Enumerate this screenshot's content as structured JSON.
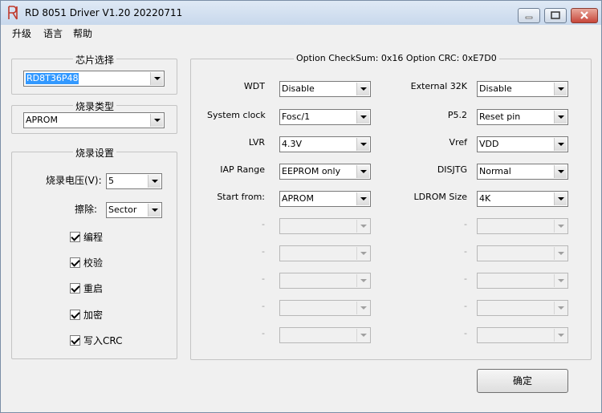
{
  "titlebar": {
    "title": "RD 8051 Driver V1.20 20220711"
  },
  "menu": [
    "升级",
    "语言",
    "帮助"
  ],
  "chip_select": {
    "title": "芯片选择",
    "value": "RD8T36P48"
  },
  "burn_type": {
    "title": "烧录类型",
    "value": "APROM"
  },
  "burn_settings": {
    "title": "烧录设置",
    "voltage_label": "烧录电压(V):",
    "voltage_value": "5",
    "erase_label": "擦除:",
    "erase_value": "Sector",
    "checkboxes": [
      {
        "label": "编程",
        "checked": true
      },
      {
        "label": "校验",
        "checked": true
      },
      {
        "label": "重启",
        "checked": true
      },
      {
        "label": "加密",
        "checked": true
      },
      {
        "label": "写入CRC",
        "checked": true
      }
    ]
  },
  "options": {
    "title": "Option CheckSum:  0x16  Option CRC:  0xE7D0",
    "left": [
      {
        "label": "WDT",
        "value": "Disable"
      },
      {
        "label": "System clock",
        "value": "Fosc/1"
      },
      {
        "label": "LVR",
        "value": "4.3V"
      },
      {
        "label": "IAP Range",
        "value": "EEPROM only"
      },
      {
        "label": "Start from:",
        "value": "APROM"
      },
      {
        "label": "-",
        "value": ""
      },
      {
        "label": "-",
        "value": ""
      },
      {
        "label": "-",
        "value": ""
      },
      {
        "label": "-",
        "value": ""
      },
      {
        "label": "-",
        "value": ""
      }
    ],
    "right": [
      {
        "label": "External 32K",
        "value": "Disable"
      },
      {
        "label": "P5.2",
        "value": "Reset pin"
      },
      {
        "label": "Vref",
        "value": "VDD"
      },
      {
        "label": "DISJTG",
        "value": "Normal"
      },
      {
        "label": "LDROM Size",
        "value": "4K"
      },
      {
        "label": "-",
        "value": ""
      },
      {
        "label": "-",
        "value": ""
      },
      {
        "label": "-",
        "value": ""
      },
      {
        "label": "-",
        "value": ""
      },
      {
        "label": "-",
        "value": ""
      }
    ]
  },
  "confirm_button": "确定"
}
